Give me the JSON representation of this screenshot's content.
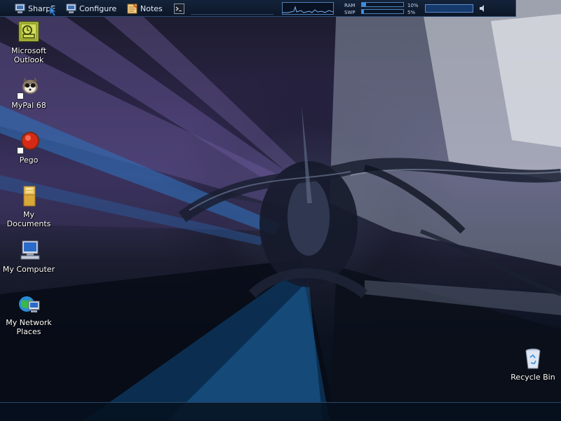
{
  "taskbar": {
    "items": [
      {
        "label": "SharpE",
        "icon": "monitor-icon"
      },
      {
        "label": "Configure",
        "icon": "monitor-icon"
      },
      {
        "label": "Notes",
        "icon": "notes-icon"
      },
      {
        "label": "",
        "icon": "terminal-icon"
      }
    ],
    "ram_label": "RAM",
    "swp_label": "SWP",
    "ram_percent": "10%",
    "swp_percent": "5%",
    "ram_value": 10,
    "swp_value": 5,
    "volume_icon": "speaker-icon"
  },
  "desktop": {
    "icons": [
      {
        "label": "Microsoft\nOutlook",
        "icon": "outlook-icon"
      },
      {
        "label": "MyPal 68",
        "icon": "mypal-icon"
      },
      {
        "label": "Pego",
        "icon": "pego-icon"
      },
      {
        "label": "My Documents",
        "icon": "folder-icon"
      },
      {
        "label": "My Computer",
        "icon": "computer-icon"
      },
      {
        "label": "My Network\nPlaces",
        "icon": "network-icon"
      },
      {
        "label": "Recycle Bin",
        "icon": "recycle-bin-icon"
      }
    ]
  },
  "colors": {
    "accent": "#3d8ee0",
    "bar_bg": "#0c1628",
    "bar_border": "#2a4a74"
  }
}
